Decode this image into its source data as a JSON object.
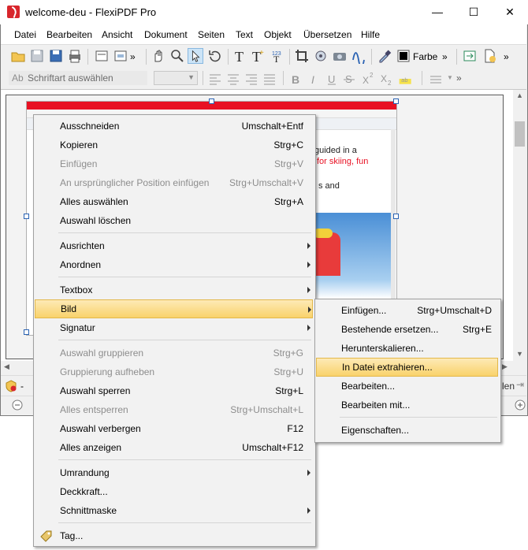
{
  "window": {
    "title": "welcome-deu - FlexiPDF Pro",
    "minimize_glyph": "—",
    "maximize_glyph": "☐",
    "close_glyph": "✕"
  },
  "menubar": [
    "Datei",
    "Bearbeiten",
    "Ansicht",
    "Dokument",
    "Seiten",
    "Text",
    "Objekt",
    "Übersetzen",
    "Hilfe"
  ],
  "toolbar": {
    "color_label": "Farbe",
    "font_placeholder": "Schriftart auswählen",
    "overflow_glyph": "»"
  },
  "document": {
    "text_line1": "guided in a",
    "text_line2": "for skiing, fun",
    "text_line3": "s and",
    "accent": "#e81123"
  },
  "context_menu": {
    "items": [
      {
        "label": "Ausschneiden",
        "shortcut": "Umschalt+Entf",
        "enabled": true
      },
      {
        "label": "Kopieren",
        "shortcut": "Strg+C",
        "enabled": true
      },
      {
        "label": "Einfügen",
        "shortcut": "Strg+V",
        "enabled": false
      },
      {
        "label": "An ursprünglicher Position einfügen",
        "shortcut": "Strg+Umschalt+V",
        "enabled": false
      },
      {
        "label": "Alles auswählen",
        "shortcut": "Strg+A",
        "enabled": true
      },
      {
        "label": "Auswahl löschen",
        "shortcut": "",
        "enabled": true
      },
      {
        "label": "Ausrichten",
        "shortcut": "",
        "enabled": true,
        "submenu": true
      },
      {
        "label": "Anordnen",
        "shortcut": "",
        "enabled": true,
        "submenu": true
      },
      {
        "label": "Textbox",
        "shortcut": "",
        "enabled": true,
        "submenu": true
      },
      {
        "label": "Bild",
        "shortcut": "",
        "enabled": true,
        "submenu": true,
        "highlighted": true
      },
      {
        "label": "Signatur",
        "shortcut": "",
        "enabled": true,
        "submenu": true
      },
      {
        "label": "Auswahl gruppieren",
        "shortcut": "Strg+G",
        "enabled": false
      },
      {
        "label": "Gruppierung aufheben",
        "shortcut": "Strg+U",
        "enabled": false
      },
      {
        "label": "Auswahl sperren",
        "shortcut": "Strg+L",
        "enabled": true
      },
      {
        "label": "Alles entsperren",
        "shortcut": "Strg+Umschalt+L",
        "enabled": false
      },
      {
        "label": "Auswahl verbergen",
        "shortcut": "F12",
        "enabled": true
      },
      {
        "label": "Alles anzeigen",
        "shortcut": "Umschalt+F12",
        "enabled": true
      },
      {
        "label": "Umrandung",
        "shortcut": "",
        "enabled": true,
        "submenu": true
      },
      {
        "label": "Deckkraft...",
        "shortcut": "",
        "enabled": true
      },
      {
        "label": "Schnittmaske",
        "shortcut": "",
        "enabled": true,
        "submenu": true
      },
      {
        "label": "Tag...",
        "shortcut": "",
        "enabled": true
      }
    ]
  },
  "submenu": {
    "items": [
      {
        "label": "Einfügen...",
        "shortcut": "Strg+Umschalt+D"
      },
      {
        "label": "Bestehende ersetzen...",
        "shortcut": "Strg+E"
      },
      {
        "label": "Herunterskalieren...",
        "shortcut": ""
      },
      {
        "label": "In Datei extrahieren...",
        "shortcut": "",
        "highlighted": true
      },
      {
        "label": "Bearbeiten...",
        "shortcut": ""
      },
      {
        "label": "Bearbeiten mit...",
        "shortcut": ""
      },
      {
        "label": "Eigenschaften...",
        "shortcut": ""
      }
    ]
  },
  "status": {
    "right_text": "len"
  }
}
